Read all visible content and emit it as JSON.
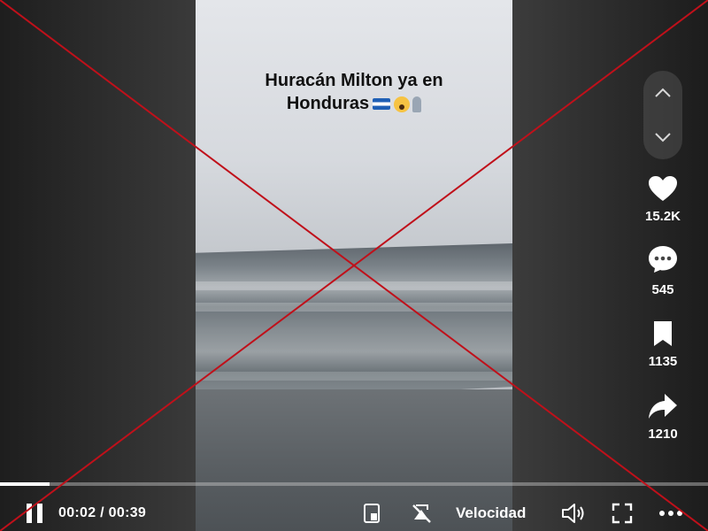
{
  "video": {
    "caption_line1": "Huracán Milton ya en",
    "caption_line2": "Honduras"
  },
  "actions": {
    "likes": "15.2K",
    "comments": "545",
    "saves": "1135",
    "shares": "1210"
  },
  "player": {
    "current_time": "00:02",
    "separator": " / ",
    "duration": "00:39",
    "progress": 0.07,
    "speed_label": "Velocidad"
  },
  "colors": {
    "overlay_cross": "#c0101a",
    "icon": "#ffffff"
  }
}
